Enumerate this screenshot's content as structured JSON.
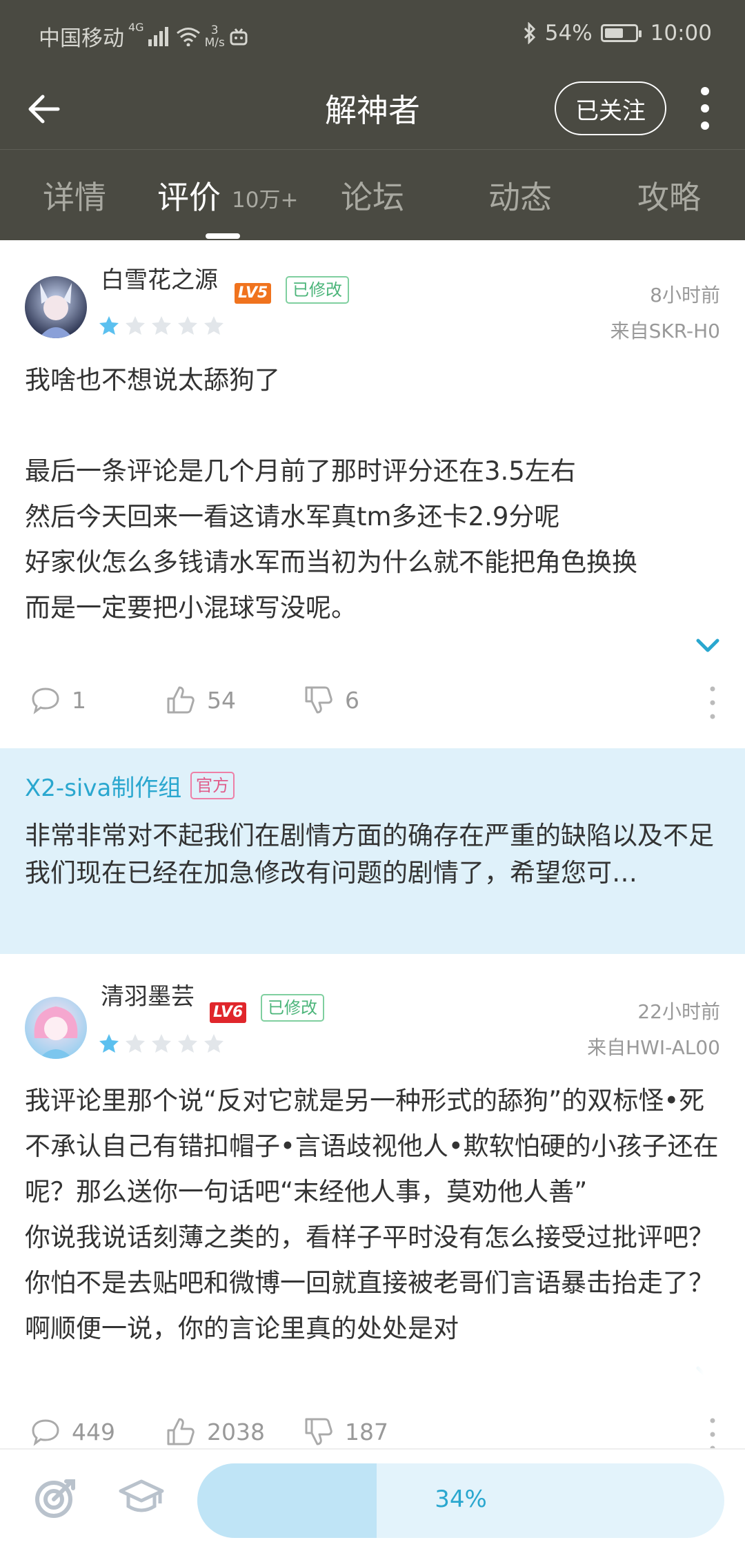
{
  "status_bar": {
    "carrier": "中国移动",
    "network": "4G",
    "speed_num": "3",
    "speed_unit": "M/s",
    "battery": "54%",
    "time": "10:00"
  },
  "header": {
    "title": "解神者",
    "follow_label": "已关注"
  },
  "tabs": [
    {
      "label": "详情"
    },
    {
      "label": "评价",
      "count": "10万+"
    },
    {
      "label": "论坛"
    },
    {
      "label": "动态"
    },
    {
      "label": "攻略"
    }
  ],
  "active_tab_index": 1,
  "reviews": [
    {
      "username": "白雪花之源",
      "level": "LV5",
      "level_color": "#f0731e",
      "modified_label": "已修改",
      "rating": 1,
      "time": "8小时前",
      "device": "来自SKR-H0",
      "text": "我啥也不想说太舔狗了\n\n最后一条评论是几个月前了那时评分还在3.5左右\n然后今天回来一看这请水军真tm多还卡2.9分呢\n好家伙怎么多钱请水军而当初为什么就不能把角色换换\n而是一定要把小混球写没呢。",
      "comments": "1",
      "likes": "54",
      "dislikes": "6"
    },
    {
      "username": "清羽墨芸",
      "level": "LV6",
      "level_color": "#e0262b",
      "modified_label": "已修改",
      "rating": 1,
      "time": "22小时前",
      "device": "来自HWI-AL00",
      "text": "我评论里那个说“反对它就是另一种形式的舔狗”的双标怪•死不承认自己有错扣帽子•言语歧视他人•欺软怕硬的小孩子还在呢？那么送你一句话吧“末经他人事，莫劝他人善”\n你说我说话刻薄之类的，看样子平时没有怎么接受过批评吧？你怕不是去贴吧和微博一回就直接被老哥们言语暴击抬走了？啊顺便一说，你的言论里真的处处是对",
      "comments": "449",
      "likes": "2038",
      "dislikes": "187"
    }
  ],
  "official_reply": {
    "name": "X2-siva制作组",
    "badge": "官方",
    "line1": "非常非常对不起我们在剧情方面的确存在严重的缺陷以及不足",
    "line2": "我们现在已经在加急修改有问题的剧情了，希望您可…"
  },
  "bottom_bar": {
    "progress_label": "34%",
    "progress_value": 0.34
  },
  "colors": {
    "header_bg": "#4a4a42",
    "accent": "#2aa7cf",
    "star_filled": "#5bc0ef",
    "star_empty": "#e2e6ea"
  },
  "icons": [
    "back-arrow-icon",
    "more-vertical-icon",
    "star-icon",
    "chevron-down-icon",
    "comment-icon",
    "thumb-up-icon",
    "thumb-down-icon",
    "target-icon",
    "graduation-cap-icon"
  ]
}
